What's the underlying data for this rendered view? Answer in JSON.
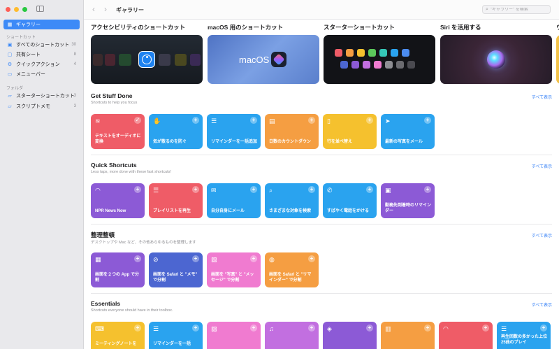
{
  "sidebar": {
    "gallery_label": "ギャラリー",
    "shortcuts_heading": "ショートカット",
    "items": [
      {
        "label": "すべてのショートカット",
        "count": "30",
        "icon": "grid-icon"
      },
      {
        "label": "共有シート",
        "count": "8",
        "icon": "share-icon"
      },
      {
        "label": "クイックアクション",
        "count": "4",
        "icon": "gear-icon"
      },
      {
        "label": "メニューバー",
        "count": "",
        "icon": "menubar-icon"
      }
    ],
    "folders_heading": "フォルダ",
    "folders": [
      {
        "label": "スターターショートカット",
        "count": "3",
        "icon": "folder-icon"
      },
      {
        "label": "スクリプトメモ",
        "count": "3",
        "icon": "folder-icon"
      }
    ]
  },
  "toolbar": {
    "title": "ギャラリー",
    "search_placeholder": "\"ギャラリー\" を検索"
  },
  "featured": [
    {
      "title": "アクセシビリティのショートカット"
    },
    {
      "title": "macOS 用のショートカット",
      "card_text": "macOS"
    },
    {
      "title": "スターターショートカット"
    },
    {
      "title": "Siri を活用する"
    },
    {
      "title": "ウ"
    }
  ],
  "sections": [
    {
      "title": "Get Stuff Done",
      "subtitle": "Shortcuts to help you focus",
      "more": "すべて表示",
      "tiles": [
        {
          "label": "テキストをオーディオに変換",
          "color": "#ef5c67",
          "icon": "waveform-icon",
          "added": true
        },
        {
          "label": "気が散るのを防ぐ",
          "color": "#2aa3ef",
          "icon": "hand-icon",
          "added": false
        },
        {
          "label": "リマインダーを一括追加",
          "color": "#2aa3ef",
          "icon": "list-icon",
          "added": false
        },
        {
          "label": "日数のカウントダウン",
          "color": "#f59e42",
          "icon": "calendar-icon",
          "added": false
        },
        {
          "label": "行を並べ替え",
          "color": "#f5c12e",
          "icon": "document-icon",
          "added": false
        },
        {
          "label": "最新の写真をメール",
          "color": "#2aa3ef",
          "icon": "paperplane-icon",
          "added": false
        }
      ]
    },
    {
      "title": "Quick Shortcuts",
      "subtitle": "Less taps, more done with these fast shortcuts!",
      "more": "すべて表示",
      "tiles": [
        {
          "label": "NPR News Now",
          "color": "#8c5ad6",
          "icon": "headphones-icon"
        },
        {
          "label": "プレイリストを再生",
          "color": "#ef5c67",
          "icon": "list-icon"
        },
        {
          "label": "自分自身にメール",
          "color": "#2aa3ef",
          "icon": "envelope-icon"
        },
        {
          "label": "さまざまな対象を検索",
          "color": "#2aa3ef",
          "icon": "search-icon"
        },
        {
          "label": "すばやく電話をかける",
          "color": "#2aa3ef",
          "icon": "phone-icon"
        },
        {
          "label": "勤務先到着時のリマインダー",
          "color": "#8c5ad6",
          "icon": "briefcase-icon"
        }
      ]
    },
    {
      "title": "整理整頓",
      "subtitle": "デスクトップや Mac など、その他あらゆるものを整理します",
      "more": "すべて表示",
      "tiles": [
        {
          "label": "画面を２つの App で分割",
          "color": "#8c5ad6",
          "icon": "grid-icon"
        },
        {
          "label": "画面を Safari と \"メモ\" で分割",
          "color": "#4c66d1",
          "icon": "compass-icon"
        },
        {
          "label": "画面を \"写真\" と \"メッセージ\" で分割",
          "color": "#f07bd0",
          "icon": "photo-icon"
        },
        {
          "label": "画面を Safari と \"リマインダー\" で分割",
          "color": "#f59e42",
          "icon": "globe-icon"
        }
      ]
    },
    {
      "title": "Essentials",
      "subtitle": "Shortcuts everyone should have in their toolbox.",
      "more": "すべて表示",
      "tiles": [
        {
          "label": "ミーティングノートを",
          "color": "#f5c12e",
          "icon": "keyboard-icon"
        },
        {
          "label": "リマインダーを一括",
          "color": "#2aa3ef",
          "icon": "list-icon"
        },
        {
          "label": "",
          "color": "#f07bd0",
          "icon": "photo-icon"
        },
        {
          "label": "",
          "color": "#c26fe0",
          "icon": "music-icon"
        },
        {
          "label": "",
          "color": "#8c5ad6",
          "icon": "layers-icon"
        },
        {
          "label": "",
          "color": "#f59e42",
          "icon": "book-icon"
        },
        {
          "label": "",
          "color": "#ef5c67",
          "icon": "headphones-icon"
        },
        {
          "label": "再生回数の多かった上位25曲のプレイ",
          "color": "#2aa3ef",
          "icon": "list-icon"
        }
      ]
    }
  ]
}
